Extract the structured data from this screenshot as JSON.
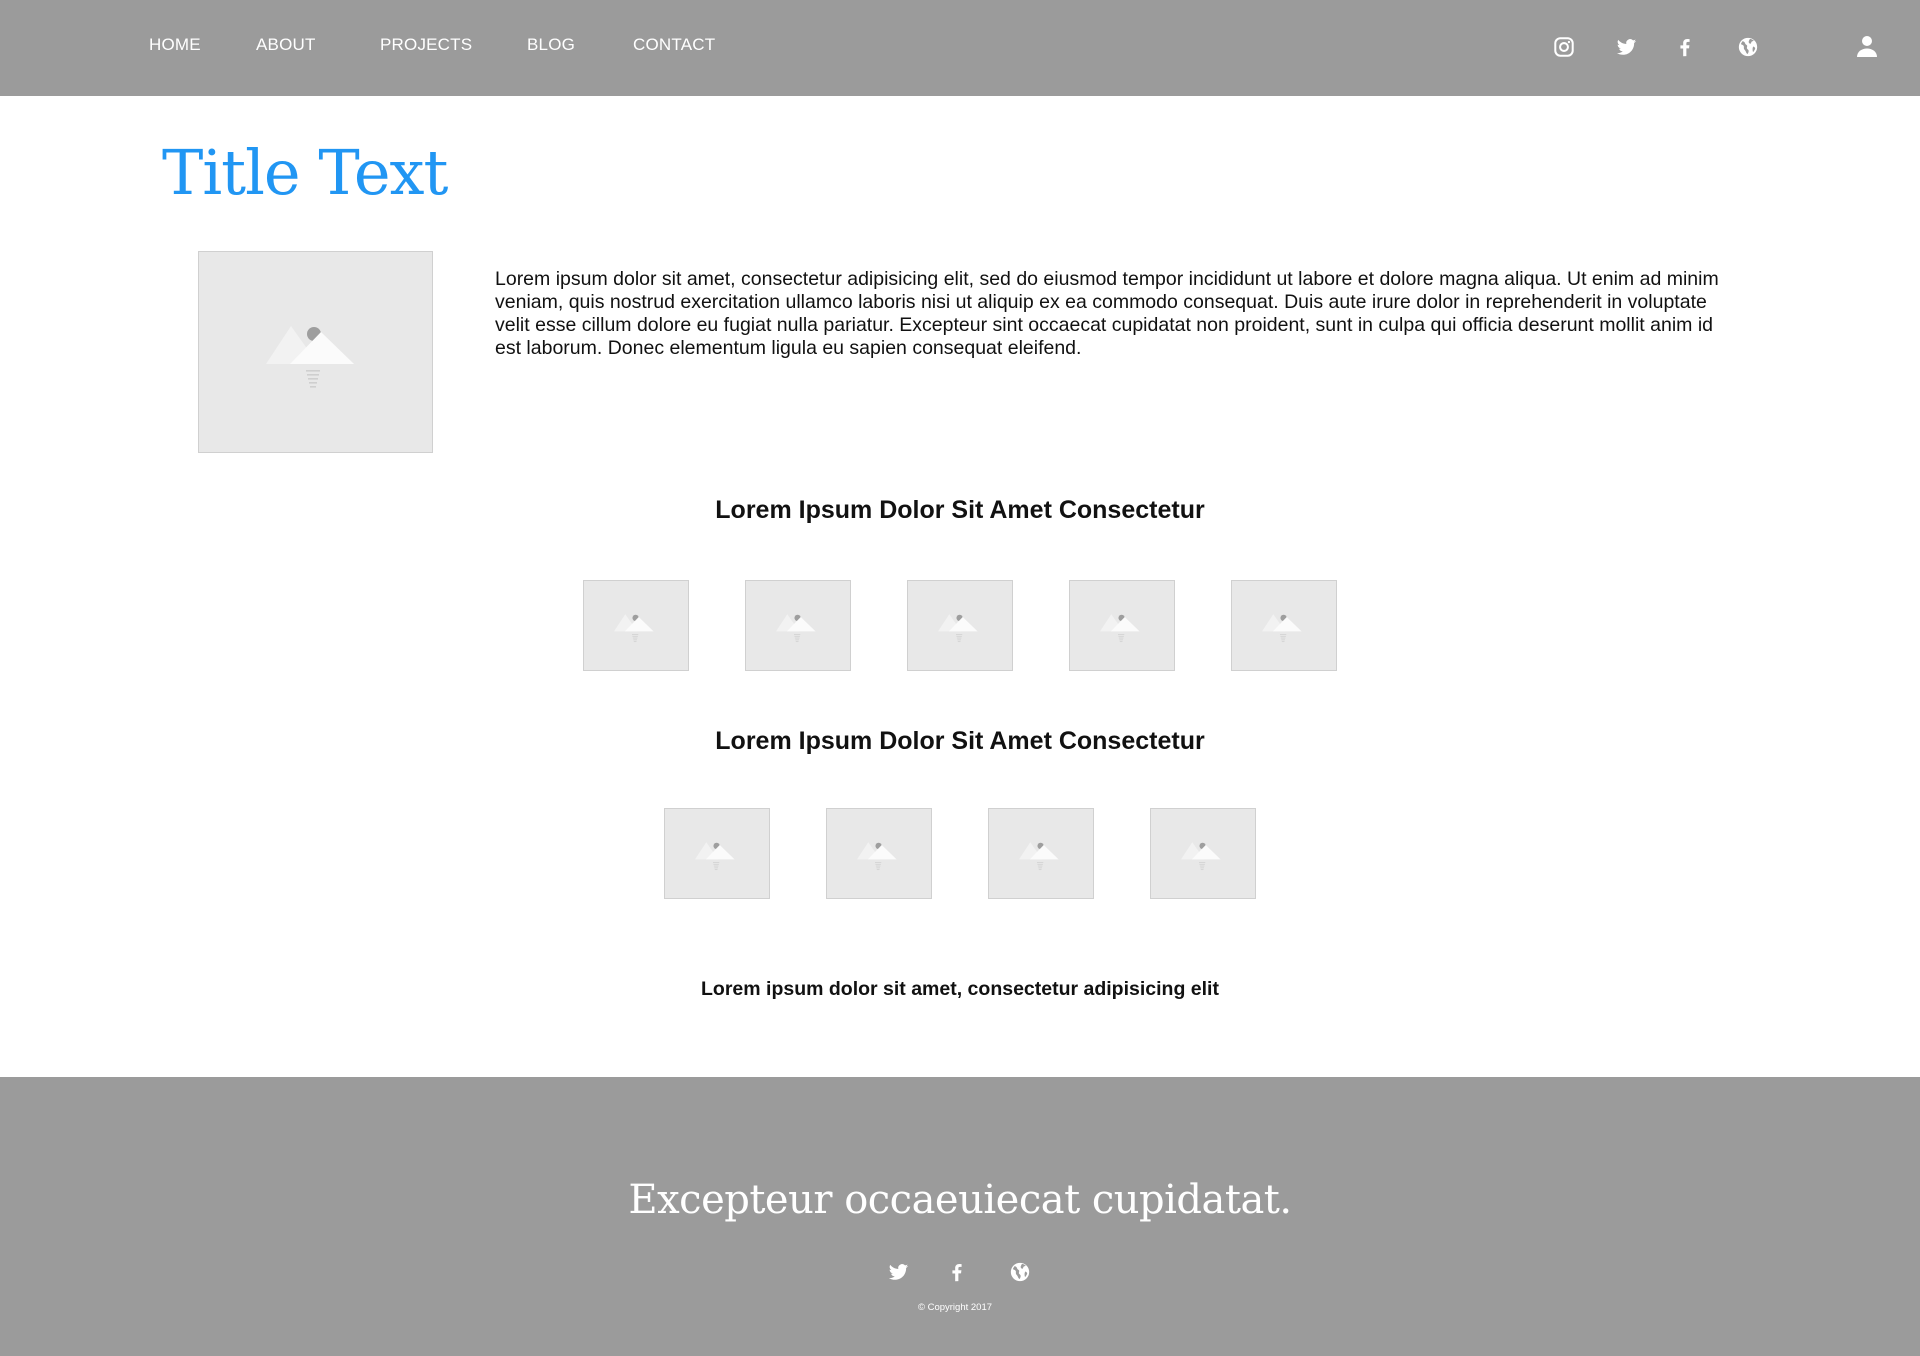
{
  "nav": {
    "items": [
      {
        "label": "HOME"
      },
      {
        "label": "ABOUT"
      },
      {
        "label": "PROJECTS"
      },
      {
        "label": "BLOG"
      },
      {
        "label": "CONTACT"
      }
    ],
    "social_icons": [
      "instagram-icon",
      "twitter-icon",
      "facebook-icon",
      "globe-icon"
    ],
    "user_icon": "user-icon"
  },
  "main": {
    "title": "Title Text",
    "intro": "Lorem ipsum dolor sit amet, consectetur adipisicing elit, sed do eiusmod tempor incididunt ut labore et dolore magna aliqua. Ut enim ad minim veniam, quis nostrud exercitation ullamco laboris nisi ut aliquip ex ea commodo consequat. Duis aute irure dolor in reprehenderit in voluptate velit esse cillum dolore eu fugiat nulla pariatur. Excepteur sint occaecat cupidatat non proident, sunt in culpa qui officia deserunt mollit anim id est laborum. Donec elementum ligula eu sapien consequat eleifend.",
    "sections": [
      {
        "heading": "Lorem Ipsum Dolor Sit Amet Consectetur"
      },
      {
        "heading": "Lorem Ipsum Dolor Sit Amet Consectetur"
      }
    ],
    "caption": "Lorem ipsum dolor sit amet, consectetur adipisicing elit"
  },
  "footer": {
    "tagline": "Excepteur occaeuiecat cupidatat.",
    "social_icons": [
      "twitter-icon",
      "facebook-icon",
      "globe-icon"
    ],
    "copyright": "© Copyright 2017"
  },
  "colors": {
    "header_bg": "#9b9b9b",
    "footer_bg": "#9b9b9b",
    "title": "#2196f3",
    "placeholder_bg": "#e8e8e8"
  }
}
